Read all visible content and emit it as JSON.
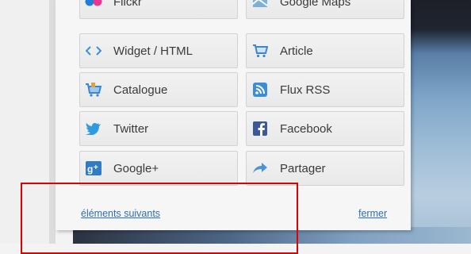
{
  "tiles": [
    {
      "label": "Flickr",
      "icon": "flickr-icon"
    },
    {
      "label": "Google Maps",
      "icon": "google-maps-icon"
    },
    {
      "label": "Widget / HTML",
      "icon": "code-icon"
    },
    {
      "label": "Article",
      "icon": "cart-icon"
    },
    {
      "label": "Catalogue",
      "icon": "catalogue-icon"
    },
    {
      "label": "Flux RSS",
      "icon": "rss-icon"
    },
    {
      "label": "Twitter",
      "icon": "twitter-icon"
    },
    {
      "label": "Facebook",
      "icon": "facebook-icon"
    },
    {
      "label": "Google+",
      "icon": "google-plus-icon"
    },
    {
      "label": "Partager",
      "icon": "share-icon"
    }
  ],
  "footer": {
    "next_label": "éléments suivants",
    "close_label": "fermer"
  },
  "colors": {
    "link": "#2d6fb1",
    "highlight_box": "#e00000"
  }
}
